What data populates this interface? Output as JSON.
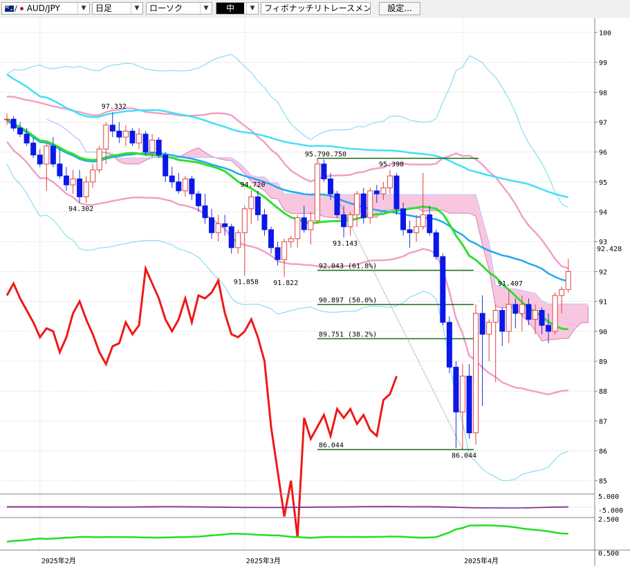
{
  "toolbar": {
    "symbol": "AUD/JPY",
    "timeframe": "日足",
    "chart_style": "ローソク",
    "size": "中",
    "tool": "フィボナッチリトレースメント",
    "settings_label": "設定..."
  },
  "chart_data": {
    "type": "candlestick",
    "title": "",
    "ylim": [
      84.6,
      100.3
    ],
    "y_ticks": [
      85,
      86,
      87,
      88,
      89,
      90,
      91,
      92,
      93,
      94,
      95,
      96,
      97,
      98,
      99,
      100
    ],
    "x_labels": [
      {
        "label": "2025年2月",
        "index": 5
      },
      {
        "label": "2025年3月",
        "index": 36
      },
      {
        "label": "2025年4月",
        "index": 69
      }
    ],
    "current_price": "92.428",
    "candles": [
      [
        97.1,
        97.3,
        96.9,
        97.1
      ],
      [
        97.1,
        97.2,
        96.7,
        96.8
      ],
      [
        96.8,
        97.0,
        96.5,
        96.6
      ],
      [
        96.6,
        96.8,
        96.2,
        96.3
      ],
      [
        96.3,
        96.5,
        95.8,
        95.9
      ],
      [
        95.9,
        96.1,
        95.5,
        95.6
      ],
      [
        95.6,
        96.3,
        94.7,
        96.2
      ],
      [
        96.2,
        96.5,
        95.5,
        95.6
      ],
      [
        95.6,
        96.1,
        95.1,
        95.2
      ],
      [
        95.2,
        95.5,
        94.7,
        94.9
      ],
      [
        94.9,
        95.4,
        94.6,
        95.1
      ],
      [
        95.1,
        95.4,
        94.3,
        94.5
      ],
      [
        94.5,
        95.2,
        94.3,
        95.0
      ],
      [
        95.0,
        95.6,
        94.8,
        95.4
      ],
      [
        95.4,
        96.2,
        95.3,
        96.1
      ],
      [
        96.1,
        97.0,
        95.6,
        96.9
      ],
      [
        96.9,
        97.33,
        96.5,
        96.7
      ],
      [
        96.7,
        97.0,
        96.3,
        96.5
      ],
      [
        96.5,
        96.9,
        96.2,
        96.7
      ],
      [
        96.7,
        96.8,
        96.2,
        96.3
      ],
      [
        96.3,
        96.8,
        96.1,
        96.6
      ],
      [
        96.6,
        96.7,
        95.9,
        96.0
      ],
      [
        96.0,
        96.6,
        95.8,
        96.4
      ],
      [
        96.4,
        96.5,
        95.8,
        95.9
      ],
      [
        95.9,
        96.0,
        95.0,
        95.2
      ],
      [
        95.2,
        95.5,
        94.8,
        95.0
      ],
      [
        95.0,
        95.3,
        94.6,
        94.7
      ],
      [
        94.7,
        95.2,
        94.5,
        95.1
      ],
      [
        95.1,
        95.2,
        94.4,
        94.6
      ],
      [
        94.6,
        94.7,
        94.0,
        94.2
      ],
      [
        94.2,
        94.6,
        93.6,
        93.8
      ],
      [
        93.8,
        94.1,
        93.1,
        93.3
      ],
      [
        93.3,
        93.9,
        93.0,
        93.6
      ],
      [
        93.6,
        93.9,
        93.2,
        93.5
      ],
      [
        93.5,
        93.6,
        92.6,
        92.8
      ],
      [
        92.8,
        93.4,
        92.6,
        93.3
      ],
      [
        93.3,
        94.2,
        91.86,
        94.1
      ],
      [
        94.1,
        94.72,
        93.6,
        94.5
      ],
      [
        94.5,
        94.7,
        93.7,
        93.9
      ],
      [
        93.9,
        94.1,
        93.2,
        93.4
      ],
      [
        93.4,
        93.5,
        92.6,
        92.8
      ],
      [
        92.8,
        93.0,
        92.2,
        92.4
      ],
      [
        92.4,
        93.1,
        91.82,
        93.0
      ],
      [
        93.0,
        93.2,
        92.8,
        93.1
      ],
      [
        93.1,
        93.9,
        92.8,
        93.8
      ],
      [
        93.8,
        94.2,
        93.3,
        93.4
      ],
      [
        93.4,
        94.0,
        92.9,
        93.7
      ],
      [
        93.7,
        95.79,
        93.6,
        95.6
      ],
      [
        95.6,
        95.75,
        95.0,
        95.1
      ],
      [
        95.1,
        95.3,
        94.4,
        94.6
      ],
      [
        94.6,
        94.7,
        93.8,
        93.9
      ],
      [
        93.9,
        94.2,
        93.143,
        93.5
      ],
      [
        93.5,
        94.0,
        93.2,
        93.9
      ],
      [
        93.9,
        94.7,
        93.5,
        94.6
      ],
      [
        94.6,
        94.8,
        93.6,
        93.8
      ],
      [
        93.8,
        94.8,
        93.6,
        94.7
      ],
      [
        94.7,
        94.9,
        94.3,
        94.6
      ],
      [
        94.6,
        95.0,
        94.4,
        94.8
      ],
      [
        94.8,
        95.398,
        94.6,
        95.2
      ],
      [
        95.2,
        95.3,
        93.9,
        94.1
      ],
      [
        94.1,
        94.3,
        93.2,
        93.4
      ],
      [
        93.4,
        93.7,
        92.8,
        93.3
      ],
      [
        93.3,
        93.9,
        93.0,
        93.5
      ],
      [
        93.5,
        95.3,
        93.4,
        93.9
      ],
      [
        93.9,
        94.2,
        93.2,
        93.3
      ],
      [
        93.3,
        93.4,
        92.4,
        92.5
      ],
      [
        92.5,
        92.6,
        90.2,
        90.3
      ],
      [
        90.3,
        90.5,
        88.6,
        88.8
      ],
      [
        88.8,
        89.0,
        86.1,
        87.3
      ],
      [
        87.3,
        88.9,
        86.044,
        88.5
      ],
      [
        88.5,
        88.9,
        86.4,
        86.6
      ],
      [
        86.6,
        90.9,
        86.2,
        90.6
      ],
      [
        90.6,
        91.2,
        87.5,
        89.9
      ],
      [
        89.9,
        90.4,
        89.0,
        90.3
      ],
      [
        90.3,
        90.9,
        88.3,
        90.7
      ],
      [
        90.7,
        90.8,
        89.5,
        90.0
      ],
      [
        90.0,
        91.407,
        89.6,
        90.9
      ],
      [
        90.9,
        91.1,
        90.1,
        90.6
      ],
      [
        90.6,
        91.2,
        90.0,
        90.9
      ],
      [
        90.9,
        91.1,
        90.2,
        90.4
      ],
      [
        90.4,
        90.9,
        89.9,
        90.7
      ],
      [
        90.7,
        90.8,
        89.9,
        90.2
      ],
      [
        90.2,
        90.6,
        89.6,
        90.0
      ],
      [
        90.0,
        91.3,
        89.9,
        91.2
      ],
      [
        91.2,
        91.5,
        90.6,
        91.4
      ],
      [
        91.4,
        92.428,
        91.3,
        92.0
      ]
    ],
    "price_labels": [
      {
        "text": "97.332",
        "index": 16,
        "value": 97.332,
        "pos": "above"
      },
      {
        "text": "94.302",
        "index": 11,
        "value": 94.302,
        "pos": "below"
      },
      {
        "text": "94.720",
        "index": 37,
        "value": 94.72,
        "pos": "above"
      },
      {
        "text": "91.858",
        "index": 36,
        "value": 91.858,
        "pos": "below"
      },
      {
        "text": "91.822",
        "index": 42,
        "value": 91.822,
        "pos": "below"
      },
      {
        "text": "95.398",
        "index": 58,
        "value": 95.398,
        "pos": "above"
      },
      {
        "text": "93.143",
        "index": 51,
        "value": 93.143,
        "pos": "below"
      },
      {
        "text": "91.407",
        "index": 76,
        "value": 91.407,
        "pos": "above"
      },
      {
        "text": "86.044",
        "index": 69,
        "value": 86.044,
        "pos": "below"
      }
    ],
    "fibonacci": {
      "high": 95.79,
      "low": 86.044,
      "high_index": 47,
      "low_index": 69,
      "top_label": "95.790.750",
      "levels": [
        {
          "label": "92.043 (61.8%)",
          "value": 92.043
        },
        {
          "label": "90.897 (50.0%)",
          "value": 90.897
        },
        {
          "label": "89.751 (38.2%)",
          "value": 89.751
        },
        {
          "label": "86.044",
          "value": 86.044
        }
      ]
    },
    "indicator_labels": [
      "5.000",
      "-5.000",
      "2.500",
      "0.500"
    ]
  }
}
